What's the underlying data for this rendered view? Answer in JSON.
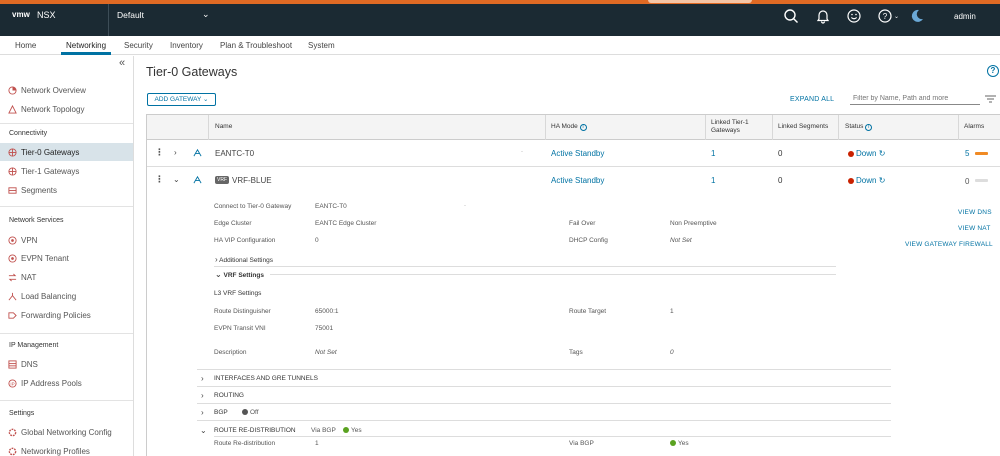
{
  "header": {
    "logo": "vmw",
    "product": "NSX",
    "context": "Default",
    "user": "admin",
    "icons": [
      "search-icon",
      "bell-icon",
      "smiley-icon",
      "help-icon",
      "moon-icon"
    ]
  },
  "nav": {
    "tabs": [
      {
        "label": "Home"
      },
      {
        "label": "Networking"
      },
      {
        "label": "Security"
      },
      {
        "label": "Inventory"
      },
      {
        "label": "Plan & Troubleshoot"
      },
      {
        "label": "System"
      }
    ],
    "active": "Networking"
  },
  "sidebar": {
    "top": [
      {
        "label": "Network Overview"
      },
      {
        "label": "Network Topology"
      }
    ],
    "connectivity": {
      "heading": "Connectivity",
      "items": [
        {
          "label": "Tier-0 Gateways"
        },
        {
          "label": "Tier-1 Gateways"
        },
        {
          "label": "Segments"
        }
      ]
    },
    "network_services": {
      "heading": "Network Services",
      "items": [
        {
          "label": "VPN"
        },
        {
          "label": "EVPN Tenant"
        },
        {
          "label": "NAT"
        },
        {
          "label": "Load Balancing"
        },
        {
          "label": "Forwarding Policies"
        }
      ]
    },
    "ip_management": {
      "heading": "IP Management",
      "items": [
        {
          "label": "DNS"
        },
        {
          "label": "IP Address Pools"
        }
      ]
    },
    "settings": {
      "heading": "Settings",
      "items": [
        {
          "label": "Global Networking Config"
        },
        {
          "label": "Networking Profiles"
        }
      ]
    }
  },
  "page": {
    "title": "Tier-0 Gateways",
    "add_button": "ADD GATEWAY",
    "expand_all": "EXPAND ALL",
    "filter_placeholder": "Filter by Name, Path and more"
  },
  "table": {
    "headers": {
      "name": "Name",
      "ha_mode": "HA Mode",
      "linked_t1_line1": "Linked Tier-1",
      "linked_t1_line2": "Gateways",
      "linked_segments": "Linked Segments",
      "status": "Status",
      "alarms": "Alarms"
    },
    "rows": [
      {
        "name": "EANTC-T0",
        "ha_mode": "Active Standby",
        "linked_t1": "1",
        "linked_segments": "0",
        "status": "Down",
        "alarms": "5"
      },
      {
        "name": "VRF-BLUE",
        "badge": "VRF",
        "ha_mode": "Active Standby",
        "linked_t1": "1",
        "linked_segments": "0",
        "status": "Down",
        "alarms": "0"
      }
    ]
  },
  "details": {
    "connect_label": "Connect to Tier-0 Gateway",
    "connect_value": "EANTC-T0",
    "edge_cluster_label": "Edge Cluster",
    "edge_cluster_value": "EANTC Edge Cluster",
    "failover_label": "Fail Over",
    "failover_value": "Non Preemptive",
    "ha_vip_label": "HA VIP Configuration",
    "ha_vip_value": "0",
    "dhcp_label": "DHCP Config",
    "dhcp_value": "Not Set",
    "additional_settings": "Additional Settings",
    "vrf_settings": "VRF Settings",
    "l3_vrf": "L3 VRF Settings",
    "rd_label": "Route Distinguisher",
    "rd_value": "65000:1",
    "rt_label": "Route Target",
    "rt_value": "1",
    "vni_label": "EVPN Transit VNI",
    "vni_value": "75001",
    "desc_label": "Description",
    "desc_value": "Not Set",
    "tags_label": "Tags",
    "tags_value": "0",
    "interfaces": "INTERFACES AND GRE TUNNELS",
    "routing": "ROUTING",
    "bgp": "BGP",
    "bgp_value": "Off",
    "redistribution": "ROUTE RE-DISTRIBUTION",
    "via_bgp_label": "Via BGP",
    "via_bgp_value": "Yes",
    "rr_label": "Route Re-distribution",
    "rr_value": "1",
    "via_bgp2_label": "Via BGP",
    "via_bgp2_value": "Yes",
    "view_dns": "VIEW DNS",
    "view_nat": "VIEW NAT",
    "view_firewall": "VIEW GATEWAY FIREWALL"
  },
  "colors": {
    "accent": "#0072a3",
    "header_bg": "#1b2a33",
    "status_down": "#c92100",
    "alarm": "#f08a24",
    "ok": "#5aa220"
  }
}
